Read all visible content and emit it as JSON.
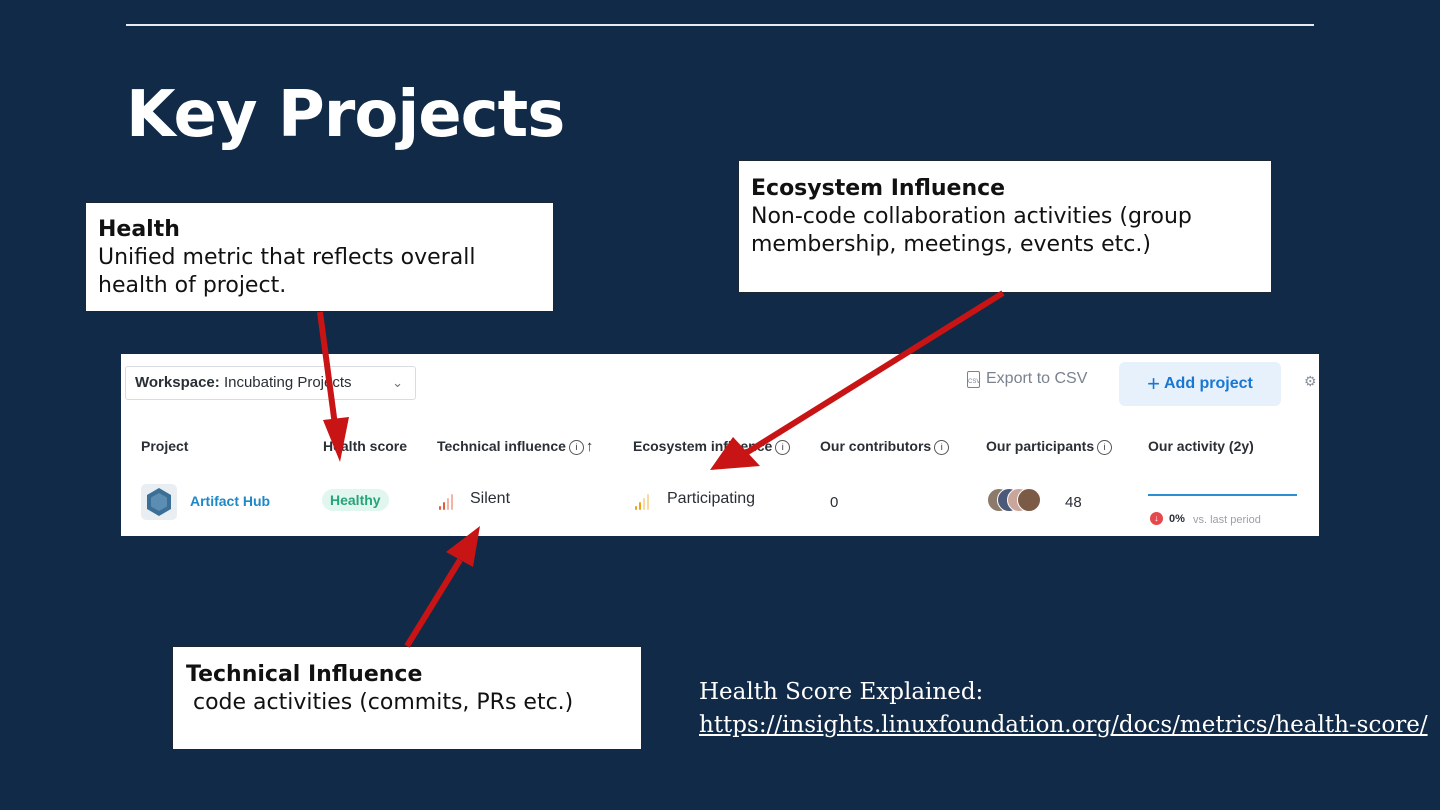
{
  "slide": {
    "title": "Key Projects"
  },
  "callouts": {
    "health": {
      "title": "Health",
      "body": "Unified metric that reflects overall health of project."
    },
    "ecosystem": {
      "title": "Ecosystem Influence",
      "body": "Non-code collaboration activities (group membership,  meetings, events etc.)"
    },
    "technical": {
      "title": "Technical Influence",
      "body": " code activities (commits, PRs etc.)"
    }
  },
  "toolbar": {
    "workspace_label": "Workspace:",
    "workspace_value": "Incubating Projects",
    "export_label": "Export to CSV",
    "csv_icon_text": "CSV",
    "add_project_label": "Add project"
  },
  "table": {
    "headers": {
      "project": "Project",
      "health": "Health score",
      "technical": "Technical influence",
      "ecosystem": "Ecosystem influence",
      "contributors": "Our contributors",
      "participants": "Our participants",
      "activity": "Our activity (2y)"
    },
    "row": {
      "project": "Artifact Hub",
      "health": "Healthy",
      "technical": "Silent",
      "ecosystem": "Participating",
      "contributors": "0",
      "participants": "48",
      "activity_change": "0%",
      "activity_vs": "vs. last period"
    }
  },
  "footer": {
    "label": "Health Score Explained:",
    "url": "https://insights.linuxfoundation.org/docs/metrics/health-score/"
  },
  "colors": {
    "background": "#112a47",
    "arrow": "#c81414",
    "healthy": "#27a37a",
    "link": "#1e88c8",
    "accent": "#1976d2"
  }
}
